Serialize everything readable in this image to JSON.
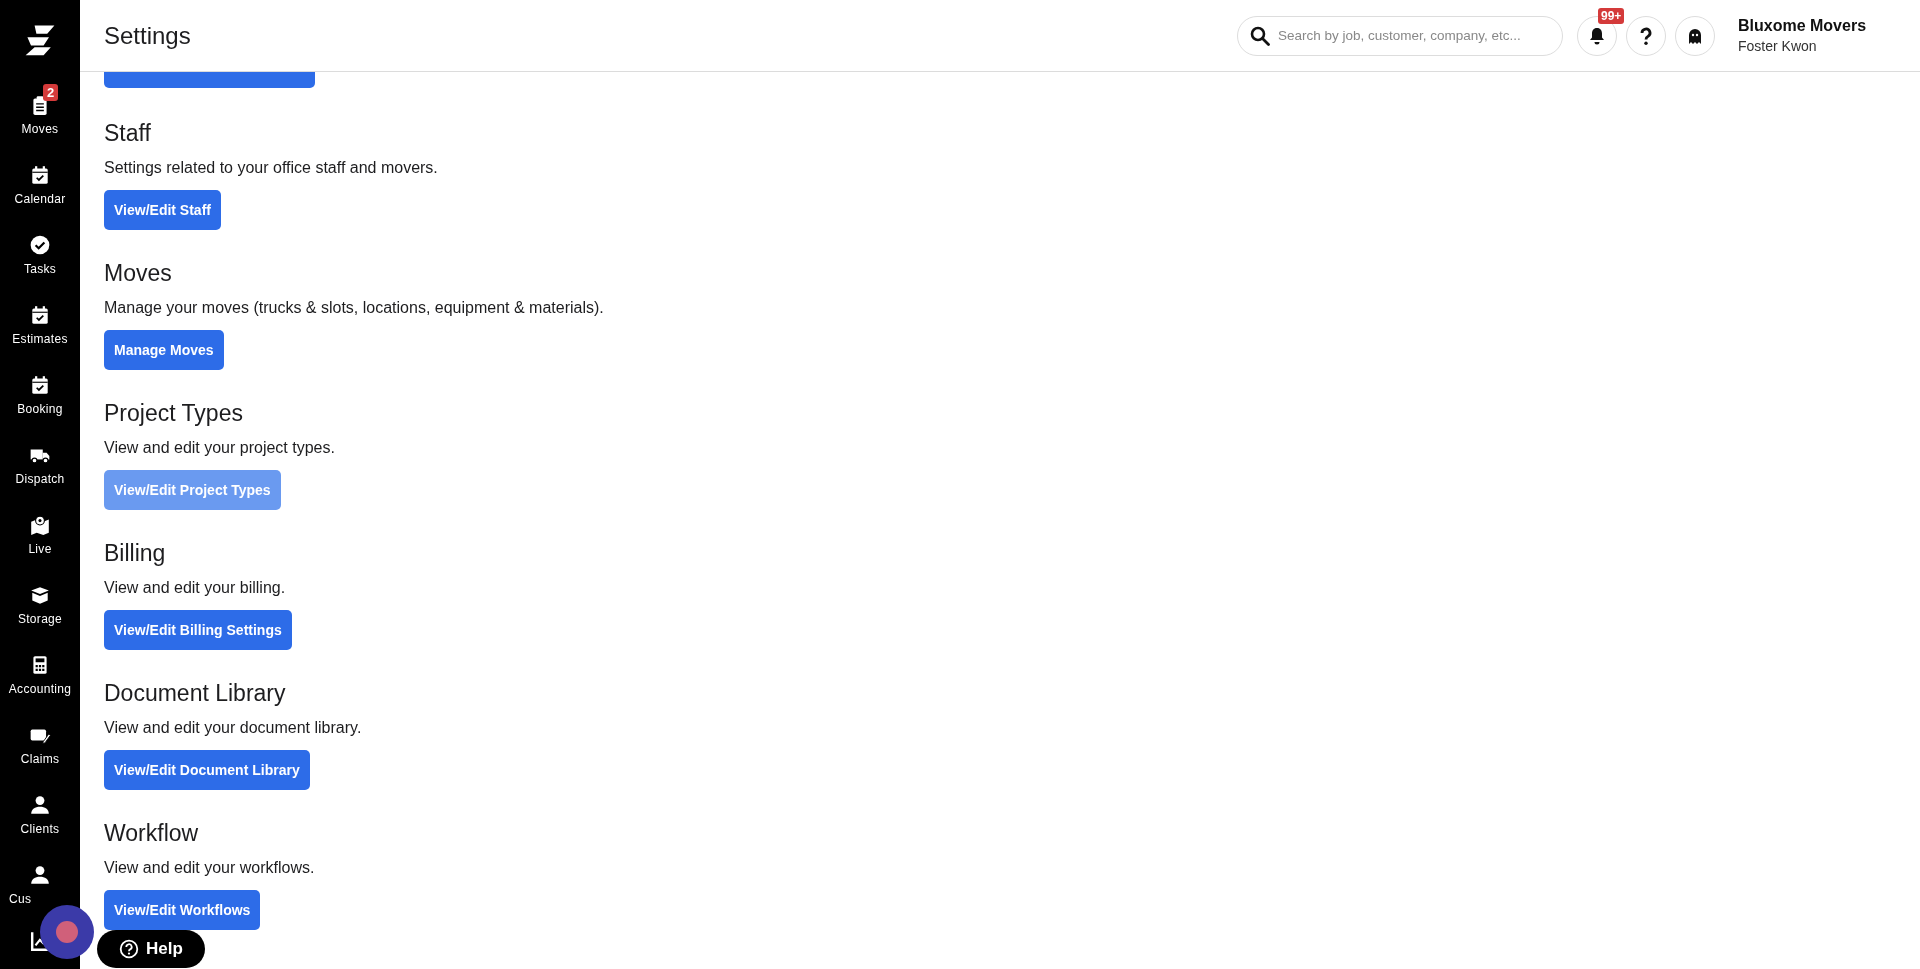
{
  "sidebar": {
    "items": [
      {
        "label": "Moves",
        "badge": "2"
      },
      {
        "label": "Calendar"
      },
      {
        "label": "Tasks"
      },
      {
        "label": "Estimates"
      },
      {
        "label": "Booking"
      },
      {
        "label": "Dispatch"
      },
      {
        "label": "Live"
      },
      {
        "label": "Storage"
      },
      {
        "label": "Accounting"
      },
      {
        "label": "Claims"
      },
      {
        "label": "Clients"
      },
      {
        "label": "Cus"
      }
    ]
  },
  "header": {
    "title": "Settings",
    "search": {
      "placeholder": "Search by job, customer, company, etc..."
    },
    "notifications_badge": "99+",
    "company": "Bluxome Movers",
    "user": "Foster Kwon"
  },
  "sections": [
    {
      "title": "Staff",
      "description": "Settings related to your office staff and movers.",
      "button": "View/Edit Staff",
      "hovered": false
    },
    {
      "title": "Moves",
      "description": "Manage your moves (trucks & slots, locations, equipment & materials).",
      "button": "Manage Moves",
      "hovered": false
    },
    {
      "title": "Project Types",
      "description": "View and edit your project types.",
      "button": "View/Edit Project Types",
      "hovered": true
    },
    {
      "title": "Billing",
      "description": "View and edit your billing.",
      "button": "View/Edit Billing Settings",
      "hovered": false
    },
    {
      "title": "Document Library",
      "description": "View and edit your document library.",
      "button": "View/Edit Document Library",
      "hovered": false
    },
    {
      "title": "Workflow",
      "description": "View and edit your workflows.",
      "button": "View/Edit Workflows",
      "hovered": false
    }
  ],
  "help_button": "Help"
}
